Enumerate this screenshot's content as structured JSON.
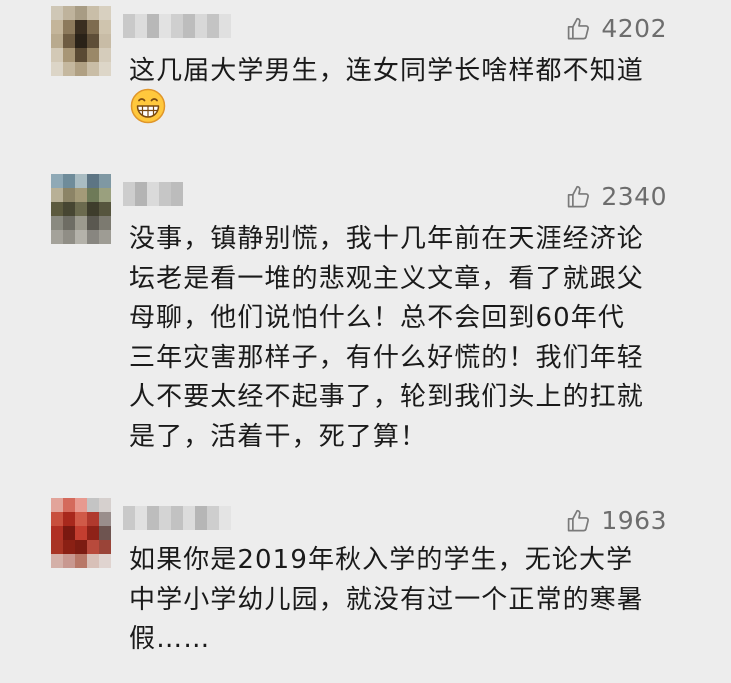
{
  "comments": [
    {
      "like_count": "4202",
      "text": "这几届大学男生，连女同学长啥样都不知道",
      "emoji": "grinning-face-emoji",
      "avatar_colors": [
        "#cfc7b6",
        "#bfb39c",
        "#a89c84",
        "#c9bea8",
        "#d8d0c0",
        "#c4b59a",
        "#8d7a5c",
        "#3a2e20",
        "#7e6c50",
        "#cfc4ae",
        "#b9aa8e",
        "#6e5c42",
        "#2a2218",
        "#5e4e38",
        "#c8bca6",
        "#d3c9b6",
        "#a89676",
        "#5a4a34",
        "#9a8868",
        "#d5ccbb",
        "#dcd5c7",
        "#c5b89f",
        "#b0a083",
        "#c9bda6",
        "#ddd6c8"
      ],
      "username_shades": [
        "#c9c9c9",
        "#dcdcdc",
        "#b8b8b8",
        "#e2e2e2",
        "#cfcfcf",
        "#bdbdbd",
        "#d8d8d8",
        "#c4c4c4",
        "#e0e0e0"
      ]
    },
    {
      "like_count": "2340",
      "text": "没事，镇静别慌，我十几年前在天涯经济论\n坛老是看一堆的悲观主义文章，看了就跟父\n母聊，他们说怕什么！总不会回到60年代\n三年灾害那样子，有什么好慌的！我们年轻\n人不要太经不起事了，轮到我们头上的扛就\n是了，活着干，死了算！",
      "emoji": "",
      "avatar_colors": [
        "#8fa9b6",
        "#6f8c9a",
        "#a9bcc2",
        "#5d7584",
        "#7f98a3",
        "#b8b096",
        "#8c8466",
        "#a39a78",
        "#6e7a58",
        "#9aa07e",
        "#5c5a3e",
        "#474632",
        "#6b6a4e",
        "#3e3d2c",
        "#56553e",
        "#8a8a80",
        "#6e6d64",
        "#9c9a8e",
        "#5a5850",
        "#7c7a70",
        "#a4a29a",
        "#908e86",
        "#b4b2aa",
        "#888680",
        "#9e9c94"
      ],
      "username_shades": [
        "#cdcdcd",
        "#b4b4b4",
        "#dadada",
        "#c6c6c6",
        "#bcbcbc"
      ]
    },
    {
      "like_count": "1963",
      "text": "如果你是2019年秋入学的学生，无论大学\n中学小学幼儿园，就没有过一个正常的寒暑\n假……",
      "emoji": "",
      "avatar_colors": [
        "#e2a49a",
        "#d46a5c",
        "#e89a90",
        "#c4c4c4",
        "#d6d0ce",
        "#c8503e",
        "#a8281c",
        "#d05a48",
        "#b03a2e",
        "#9a8e8c",
        "#b03024",
        "#7a1810",
        "#c43e30",
        "#8e2218",
        "#6e5450",
        "#a83424",
        "#8a2014",
        "#7c1c12",
        "#b84a3c",
        "#9a4438",
        "#d4b0a8",
        "#c89890",
        "#b87868",
        "#d8c0b8",
        "#e0d4d0"
      ],
      "username_shades": [
        "#c9c9c9",
        "#e0e0e0",
        "#bdbdbd",
        "#d4d4d4",
        "#c2c2c2",
        "#dcdcdc",
        "#b6b6b6",
        "#cecece",
        "#e4e4e4"
      ]
    }
  ]
}
